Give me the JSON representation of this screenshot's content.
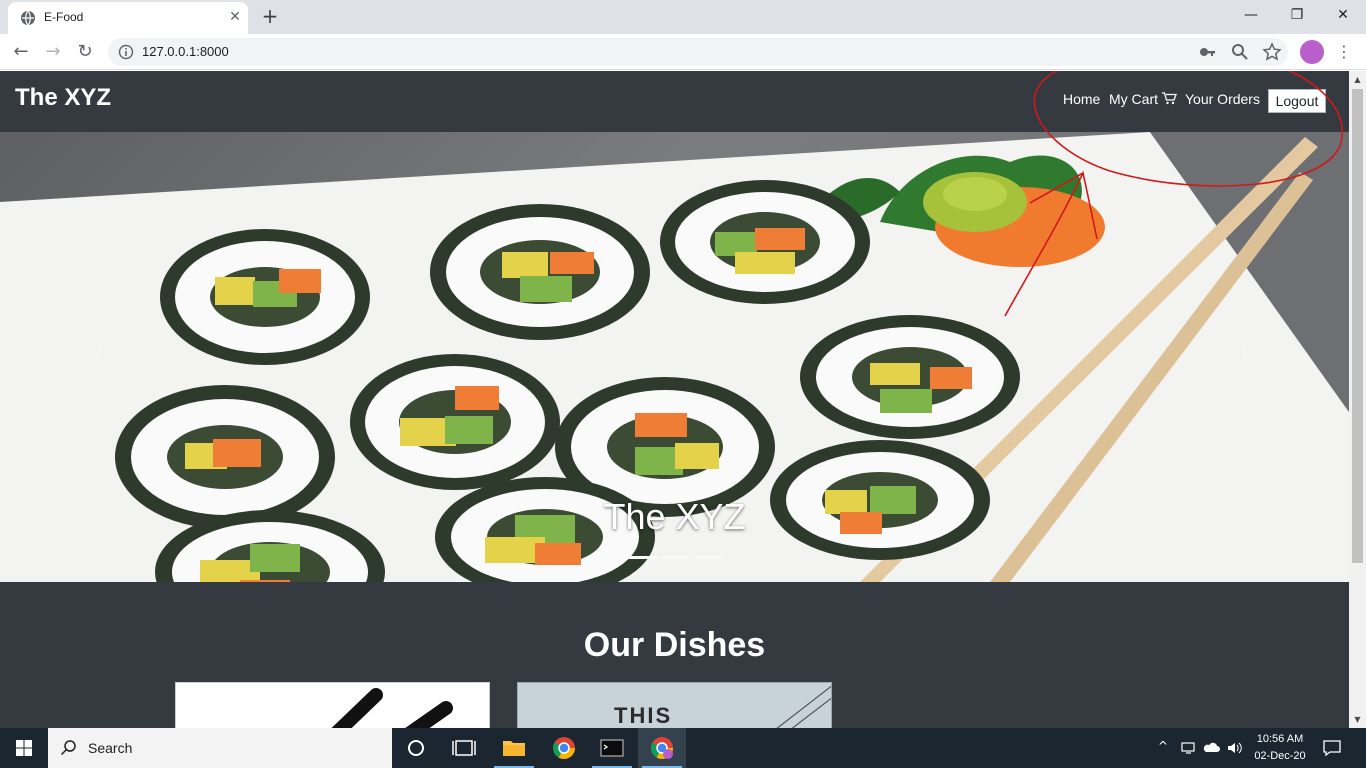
{
  "browser": {
    "tab_title": "E-Food",
    "url": "127.0.0.1:8000"
  },
  "site": {
    "brand": "The XYZ",
    "nav": {
      "home": "Home",
      "cart": "My Cart",
      "orders": "Your Orders",
      "logout": "Logout"
    },
    "carousel": {
      "caption": "The XYZ",
      "slide_count": 3,
      "active_slide": 0
    },
    "dishes_title": "Our Dishes",
    "dish_cards": [
      {
        "image_text": ""
      },
      {
        "image_text": "THIS"
      }
    ]
  },
  "taskbar": {
    "search_label": "Search",
    "time": "10:56 AM",
    "date": "02-Dec-20"
  },
  "colors": {
    "navbar": "#343a40",
    "annotation": "#d0191b",
    "taskbar": "#1b2630"
  },
  "icons": [
    "globe-icon",
    "close-icon",
    "plus-icon",
    "back-icon",
    "forward-icon",
    "reload-icon",
    "info-icon",
    "key-icon",
    "zoom-icon",
    "star-icon",
    "cart-icon",
    "windows-icon",
    "search-icon",
    "cortana-icon",
    "task-view-icon",
    "file-explorer-icon",
    "chrome-icon",
    "terminal-icon",
    "notification-icon"
  ]
}
